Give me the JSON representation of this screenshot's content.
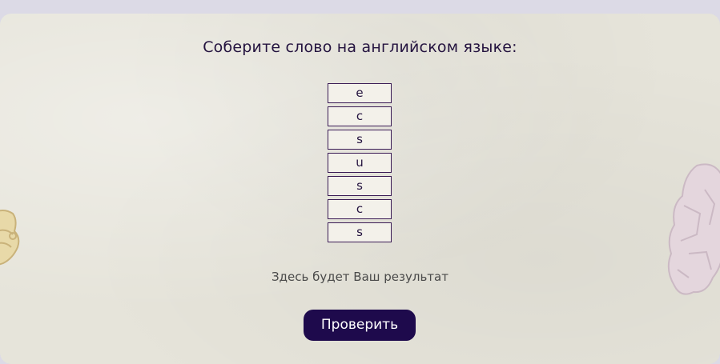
{
  "prompt": {
    "text": "Соберите слово на английском языке:"
  },
  "letters": [
    "e",
    "c",
    "s",
    "u",
    "s",
    "c",
    "s"
  ],
  "result": {
    "text": "Здесь будет Ваш результат"
  },
  "check_button": {
    "label": "Проверить"
  },
  "colors": {
    "accent": "#1e0a4c",
    "text_dark": "#24133f",
    "paper": "#e6e4da",
    "frame": "#dcdae6"
  },
  "icons": {
    "left_decoration": "scroll-illustration-icon",
    "right_decoration": "rock-illustration-icon"
  }
}
